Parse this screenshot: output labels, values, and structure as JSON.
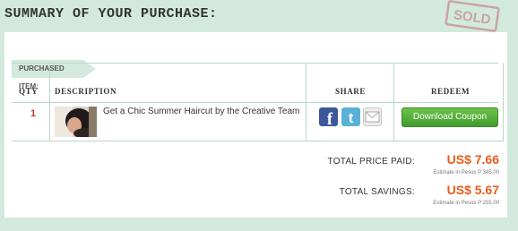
{
  "page": {
    "heading": "SUMMARY OF YOUR PURCHASE:",
    "stamp_text": "SOLD"
  },
  "section": {
    "label": "PURCHASED ITEM:"
  },
  "table": {
    "columns": [
      "QTY",
      "DESCRIPTION",
      "SHARE",
      "REDEEM"
    ],
    "row": {
      "qty": "1",
      "description": "Get a Chic Summer Haircut by the Creative Team",
      "share_icons": [
        "facebook-icon",
        "twitter-icon",
        "email-icon"
      ],
      "redeem_label": "Download Coupon"
    }
  },
  "totals": {
    "price_label": "TOTAL PRICE PAID:",
    "price_value": "US$ 7.66",
    "price_estimate": "Estimate in Pesos P 345.00",
    "savings_label": "TOTAL SAVINGS:",
    "savings_value": "US$ 5.67",
    "savings_estimate": "Estimate in Pesos P 255.00"
  },
  "colors": {
    "page_background": "#d3e9dd",
    "accent_orange": "#e85c1c",
    "qty_red": "#c0392b",
    "button_green": "#4aa832",
    "facebook_blue": "#3b5998",
    "twitter_blue": "#5ab0d6"
  }
}
